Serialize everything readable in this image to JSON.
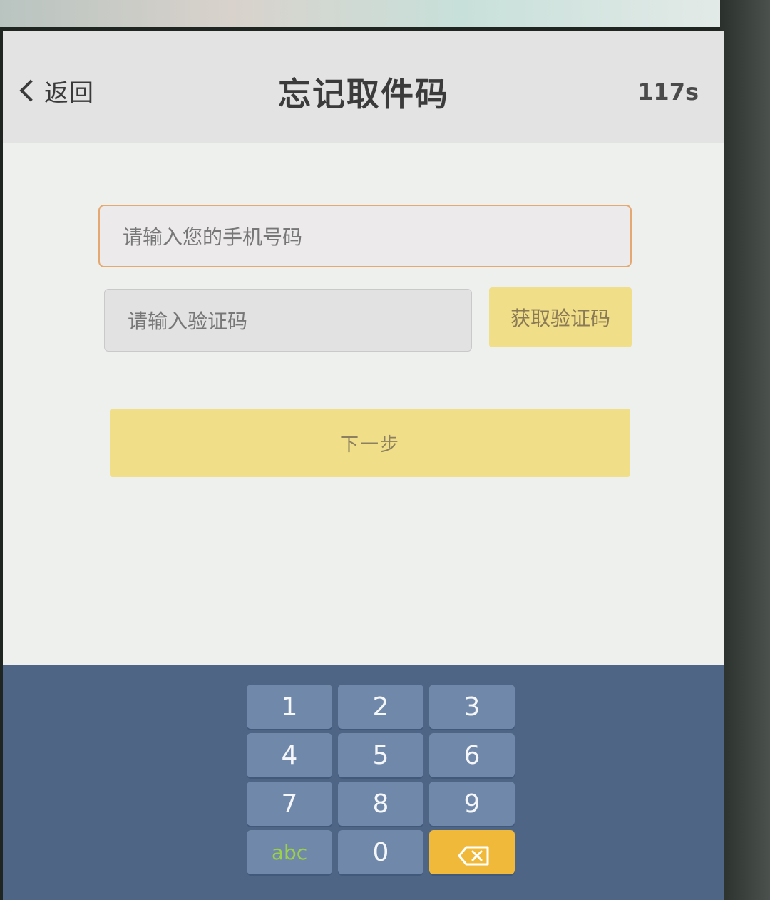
{
  "header": {
    "back_label": "返回",
    "title": "忘记取件码",
    "countdown": "117s"
  },
  "form": {
    "phone_placeholder": "请输入您的手机号码",
    "code_placeholder": "请输入验证码",
    "get_code_label": "获取验证码",
    "next_label": "下一步"
  },
  "keyboard": {
    "keys": [
      "1",
      "2",
      "3",
      "4",
      "5",
      "6",
      "7",
      "8",
      "9",
      "abc",
      "0"
    ],
    "delete_icon": "backspace-icon",
    "abc_color": "#9ad04a",
    "delete_color": "#f0b93a"
  },
  "colors": {
    "accent_yellow": "#f1de88",
    "keyboard_bg": "#4e6585",
    "key_bg": "#7088aa",
    "phone_border": "#e6a871"
  }
}
